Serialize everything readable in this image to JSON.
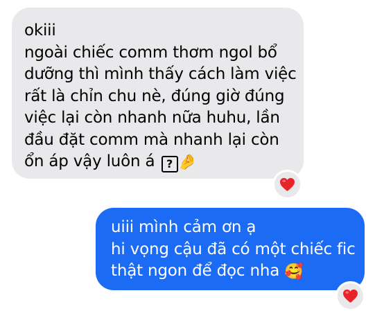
{
  "messages": [
    {
      "direction": "incoming",
      "lines": [
        "okiii",
        "ngoài chiếc comm thơm ngol bổ",
        "dưỡng thì mình thấy cách làm việc",
        "rất là chỉn chu nè, đúng giờ đúng",
        "việc lại còn nhanh nữa huhu, lần",
        "đầu đặt comm mà nhanh lại còn",
        "ổn áp vậy luôn á"
      ],
      "trailing_symbols": [
        "?",
        "🤌"
      ],
      "reaction": "❤️"
    },
    {
      "direction": "outgoing",
      "lines": [
        "uiii mình cảm ơn ạ",
        "hi vọng cậu đã có một chiếc fic",
        "thật ngon để đọc nha"
      ],
      "trailing_symbols": [
        "🥰"
      ],
      "reaction": "❤️"
    }
  ],
  "colors": {
    "incoming_bubble": "#e9e9eb",
    "outgoing_bubble": "#1b6bf5",
    "heart": "#e8242b"
  }
}
